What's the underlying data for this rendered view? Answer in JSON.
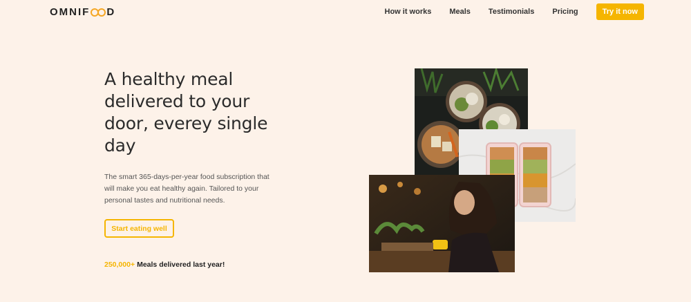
{
  "brand": {
    "logo_left": "OMNIF",
    "logo_right": "D",
    "accent": "#f5b500",
    "background": "#fdf2e9"
  },
  "nav": {
    "items": [
      {
        "label": "How it works"
      },
      {
        "label": "Meals"
      },
      {
        "label": "Testimonials"
      },
      {
        "label": "Pricing"
      }
    ],
    "cta_label": "Try it now"
  },
  "hero": {
    "title": "A healthy meal delivered to your door, everey single day",
    "description": "The smart 365-days-per-year food subscription that will make you eat healthy again. Tailored to your personal tastes and nutritional needs.",
    "button_label": "Start eating well",
    "delivered_count": "250,000+",
    "delivered_text": "Meals delivered last year!"
  },
  "images": {
    "bowls": "food-bowls-photo",
    "boxes": "meal-prep-boxes-photo",
    "woman": "woman-eating-photo"
  }
}
